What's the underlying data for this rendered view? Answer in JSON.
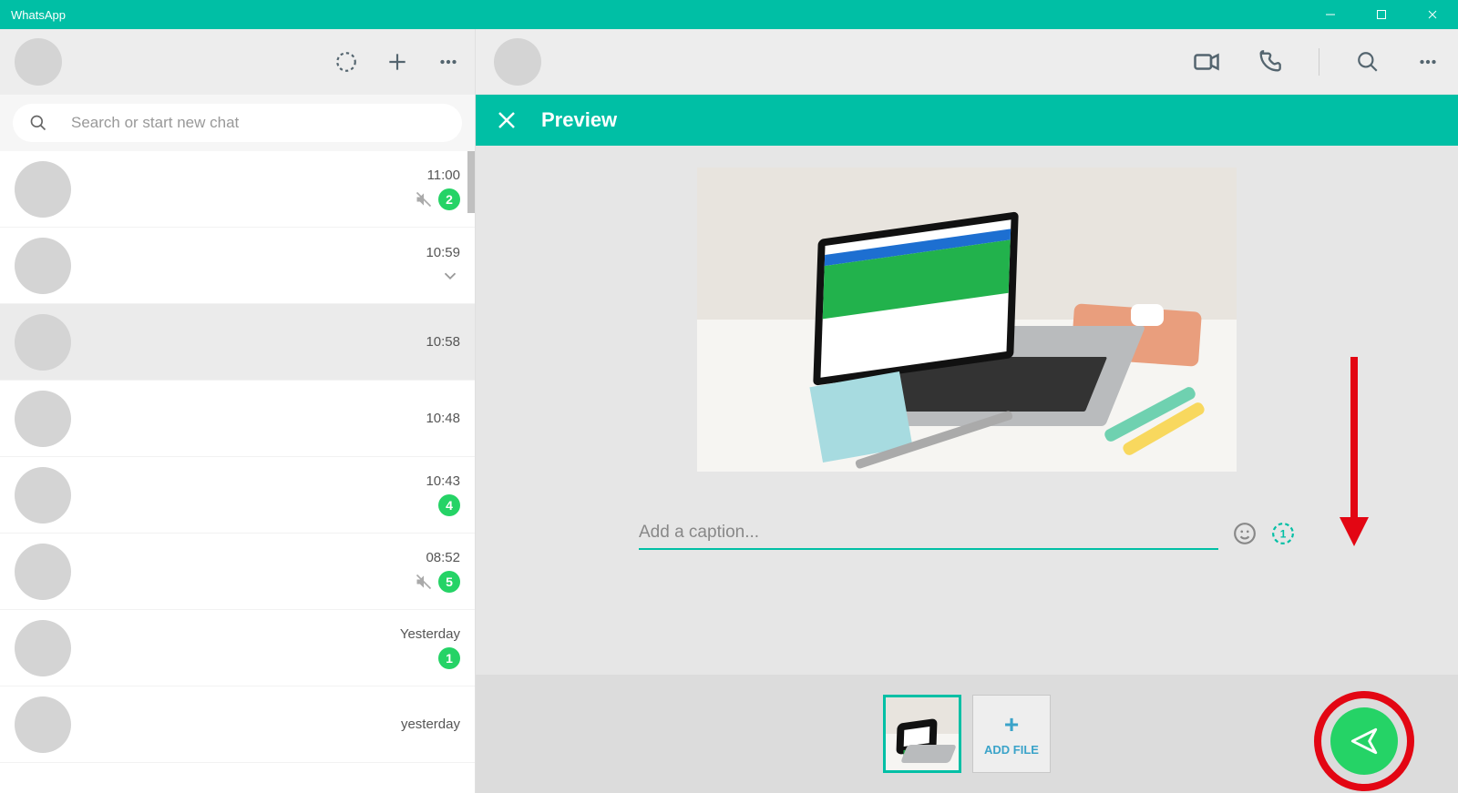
{
  "window": {
    "title": "WhatsApp"
  },
  "left": {
    "search_placeholder": "Search or start new chat",
    "chats": [
      {
        "time": "11:00",
        "muted": true,
        "unread": "2",
        "selected": false
      },
      {
        "time": "10:59",
        "chevron": true,
        "selected": false
      },
      {
        "time": "10:58",
        "selected": true
      },
      {
        "time": "10:48",
        "selected": false
      },
      {
        "time": "10:43",
        "unread": "4",
        "selected": false
      },
      {
        "time": "08:52",
        "muted": true,
        "unread": "5",
        "selected": false
      },
      {
        "time": "Yesterday",
        "unread": "1",
        "selected": false
      },
      {
        "time": "yesterday",
        "selected": false
      }
    ]
  },
  "preview": {
    "title": "Preview",
    "caption_placeholder": "Add a caption...",
    "add_file_label": "ADD FILE"
  },
  "colors": {
    "teal": "#00bfa5",
    "green": "#25d366",
    "anno": "#e30613"
  }
}
